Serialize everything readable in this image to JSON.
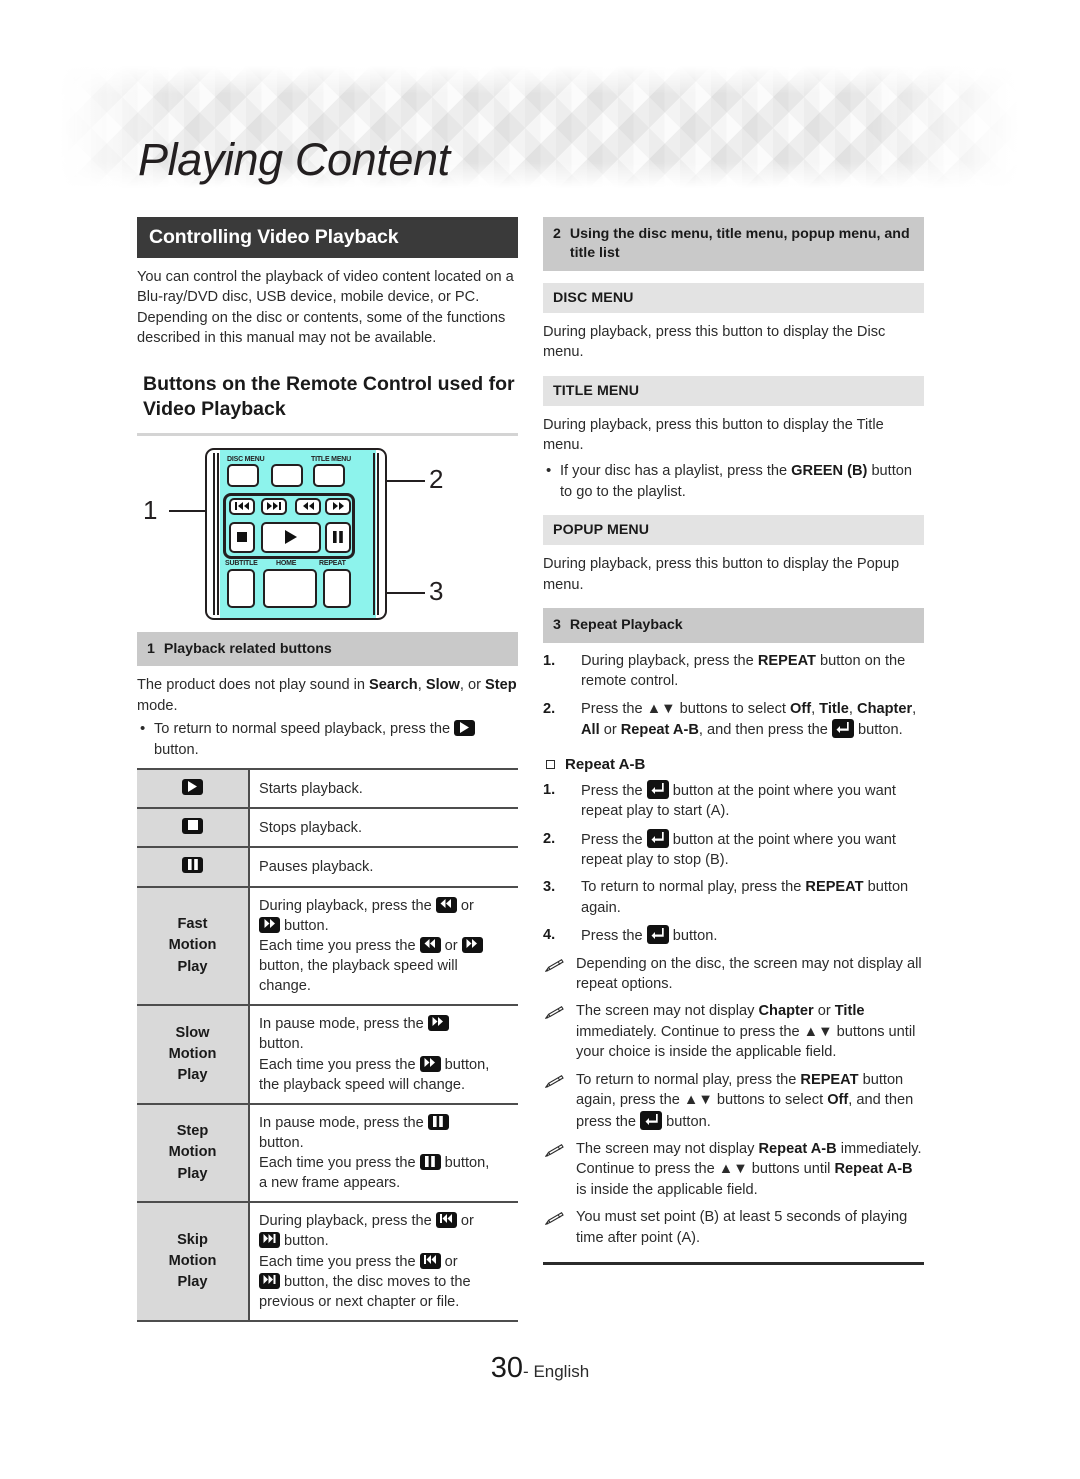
{
  "header": {
    "title": "Playing Content"
  },
  "left": {
    "section_title": "Controlling Video Playback",
    "intro": "You can control the playback of video content located on a Blu-ray/DVD disc, USB device, mobile device, or PC. Depending on the disc or contents, some of the functions described in this manual may not be available.",
    "heading": "Buttons on the Remote Control used for Video Playback",
    "remote": {
      "callouts": [
        "1",
        "2",
        "3"
      ],
      "labels": {
        "disc_menu": "DISC MENU",
        "title_menu": "TITLE MENU",
        "subtitle": "SUBTITLE",
        "home": "HOME",
        "repeat": "REPEAT"
      },
      "highlight_color": "#8df3ec"
    },
    "group1": {
      "number": "1",
      "title": "Playback related buttons"
    },
    "note_intro_a": "The product does not play sound in ",
    "note_intro_search": "Search",
    "note_intro_b": ", ",
    "note_intro_slow": "Slow",
    "note_intro_c": ", or ",
    "note_intro_step": "Step",
    "note_intro_d": " mode.",
    "bullet_a": "To return to normal speed playback, press the ",
    "bullet_b": " button.",
    "table": {
      "rows": [
        {
          "key": "icon:play",
          "key_text": "",
          "desc_html": "Starts playback."
        },
        {
          "key": "icon:stop",
          "key_text": "",
          "desc_html": "Stops playback."
        },
        {
          "key": "icon:pause",
          "key_text": "",
          "desc_html": "Pauses playback."
        },
        {
          "key": "text",
          "key_text": "Fast\nMotion\nPlay",
          "desc_html": "During playback, press the [rew] or [ff] button.\nEach time you press the [rew] or [ff] button, the playback speed will change."
        },
        {
          "key": "text",
          "key_text": "Slow\nMotion\nPlay",
          "desc_html": "In pause mode, press the [ff] button.\nEach time you press the [ff] button, the playback speed will change."
        },
        {
          "key": "text",
          "key_text": "Step\nMotion\nPlay",
          "desc_html": "In pause mode, press the [pause] button.\nEach time you press the [pause] button, a new frame appears."
        },
        {
          "key": "text",
          "key_text": "Skip\nMotion\nPlay",
          "desc_html": "During playback, press the [prev] or [next] button.\nEach time you press the [prev] or [next] button, the disc moves to the previous or next chapter or file."
        }
      ]
    }
  },
  "right": {
    "group2": {
      "number": "2",
      "title": "Using the disc menu, title menu, popup menu, and title list"
    },
    "disc_menu_head": "DISC MENU",
    "disc_menu_body": "During playback, press this button to display the Disc menu.",
    "title_menu_head": "TITLE MENU",
    "title_menu_body": "During playback, press this button to display the Title menu.",
    "title_menu_bullet_a": "If your disc has a playlist, press the ",
    "title_menu_bullet_green": "GREEN (B)",
    "title_menu_bullet_b": " button to go to the playlist.",
    "popup_menu_head": "POPUP MENU",
    "popup_menu_body": "During playback, press this button to display the Popup menu.",
    "group3": {
      "number": "3",
      "title": "Repeat Playback"
    },
    "repeat_steps": [
      {
        "n": "1.",
        "a": "During playback, press the ",
        "bold": "REPEAT",
        "b": " button on the remote control."
      }
    ],
    "step2": {
      "n": "2.",
      "t1": "Press the ",
      "t2": " buttons to select ",
      "off": "Off",
      "c1": ", ",
      "title": "Title",
      "c2": ", ",
      "chapter": "Chapter",
      "c3": ", ",
      "all": "All",
      "c4": " or ",
      "ab": "Repeat A-B",
      "c5": ", and then press the ",
      "c6": " button."
    },
    "repeat_ab_head": "Repeat A-B",
    "ab_steps": [
      {
        "n": "1.",
        "a": "Press the ",
        "b": " button at the point where you want repeat play to start (A)."
      },
      {
        "n": "2.",
        "a": "Press the ",
        "b": " button at the point where you want repeat play to stop (B)."
      }
    ],
    "ab_step3": {
      "n": "3.",
      "a": "To return to normal play, press the ",
      "bold": "REPEAT",
      "b": " button again."
    },
    "ab_step4": {
      "n": "4.",
      "a": "Press the ",
      "b": " button."
    },
    "notes": [
      {
        "parts": [
          {
            "t": "Depending on the disc, the screen may not display all repeat options."
          }
        ]
      },
      {
        "parts": [
          {
            "t": "The screen may not display "
          },
          {
            "t": "Chapter",
            "bold": true
          },
          {
            "t": " or "
          },
          {
            "t": "Title",
            "bold": true
          },
          {
            "t": " immediately. Continue to press the "
          },
          {
            "t": "[updown]"
          },
          {
            "t": " buttons until your choice is inside the applicable field."
          }
        ]
      },
      {
        "parts": [
          {
            "t": "To return to normal play, press the "
          },
          {
            "t": "REPEAT",
            "bold": true
          },
          {
            "t": " button again, press the "
          },
          {
            "t": "[updown]"
          },
          {
            "t": " buttons to select "
          },
          {
            "t": "Off",
            "bold": true
          },
          {
            "t": ", and then press the "
          },
          {
            "t": "[enter]"
          },
          {
            "t": " button."
          }
        ]
      },
      {
        "parts": [
          {
            "t": "The screen may not display "
          },
          {
            "t": "Repeat A-B",
            "bold": true
          },
          {
            "t": " immediately. Continue to press the "
          },
          {
            "t": "[updown]"
          },
          {
            "t": " buttons until "
          },
          {
            "t": "Repeat A-B",
            "bold": true
          },
          {
            "t": " is inside the applicable field."
          }
        ]
      },
      {
        "parts": [
          {
            "t": "You must set point (B) at least 5 seconds of playing time after point (A)."
          }
        ]
      }
    ]
  },
  "footer": {
    "page": "30",
    "separator": "- ",
    "language": "English"
  }
}
